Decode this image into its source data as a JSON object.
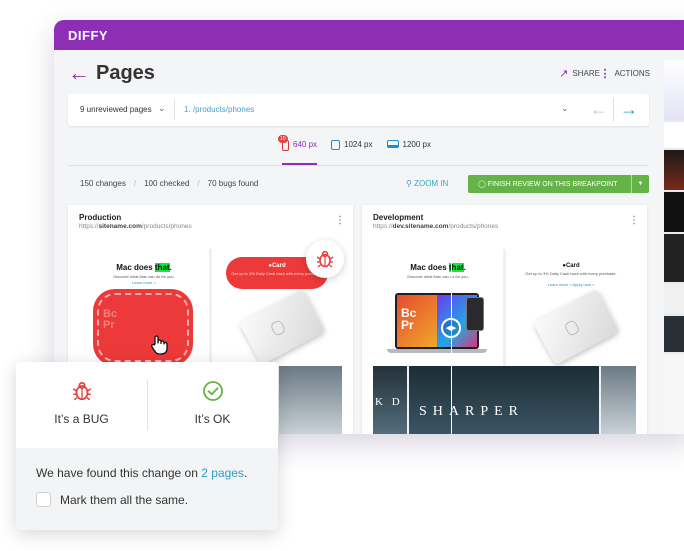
{
  "app": {
    "name": "DIFFY"
  },
  "header": {
    "title": "Pages",
    "share_label": "SHARE",
    "actions_label": "ACTIONS"
  },
  "pagebar": {
    "selector_label": "9 unreviewed pages",
    "current_url": "1. /products/phones"
  },
  "breakpoints": [
    {
      "label": "640 px",
      "badge": "10"
    },
    {
      "label": "1024 px"
    },
    {
      "label": "1200 px"
    }
  ],
  "stats": {
    "changes": "150 changes",
    "checked": "100 checked",
    "bugs": "70 bugs found",
    "separator": "/"
  },
  "toolbar": {
    "zoom_label": "ZOOM IN",
    "finish_label": "FINISH REVIEW ON THIS BREAKPOINT"
  },
  "panels": {
    "production": {
      "title": "Production",
      "url_prefix": "https://",
      "url_domain": "sitename.com",
      "url_path": "/products/phones"
    },
    "development": {
      "title": "Development",
      "url_prefix": "https://",
      "url_domain": "dev.sitename.com",
      "url_path": "/products/phones"
    }
  },
  "preview": {
    "mac_title_before": "Mac does ",
    "mac_title_highlight": "that",
    "mac_title_after": ".",
    "mac_sub": "Discover what Mac can do for you.",
    "mac_link": "Learn more >",
    "dev_mac_title_before": "Mac does ",
    "dev_mac_title_highlight": "that",
    "dev_mac_title_after": ".",
    "dev_mac_sub": "Discover what Mac can do for you.",
    "card_title": "Card",
    "card_sub": "Get up to 3% Daily Cash back with every purchase.",
    "card_link": "Learn more >   Apply now >",
    "film_text": "SHARPER",
    "film_text_small": "K D"
  },
  "popover": {
    "bug_label": "It’s a BUG",
    "ok_label": "It’s OK",
    "message_before": "We have found this change on ",
    "message_link": "2 pages",
    "message_after": ".",
    "mark_all_label": "Mark them all the same."
  },
  "colors": {
    "brand": "#8e2eb5",
    "accent": "#33a6c4",
    "success": "#64b347",
    "bug": "#e0433d"
  },
  "icons": [
    "back-arrow-icon",
    "share-icon",
    "more-vertical-icon",
    "chevron-down-icon",
    "prev-arrow-icon",
    "next-arrow-icon",
    "mobile-icon",
    "tablet-icon",
    "desktop-icon",
    "zoom-icon",
    "check-circle-icon",
    "bug-icon",
    "hand-cursor-icon"
  ]
}
